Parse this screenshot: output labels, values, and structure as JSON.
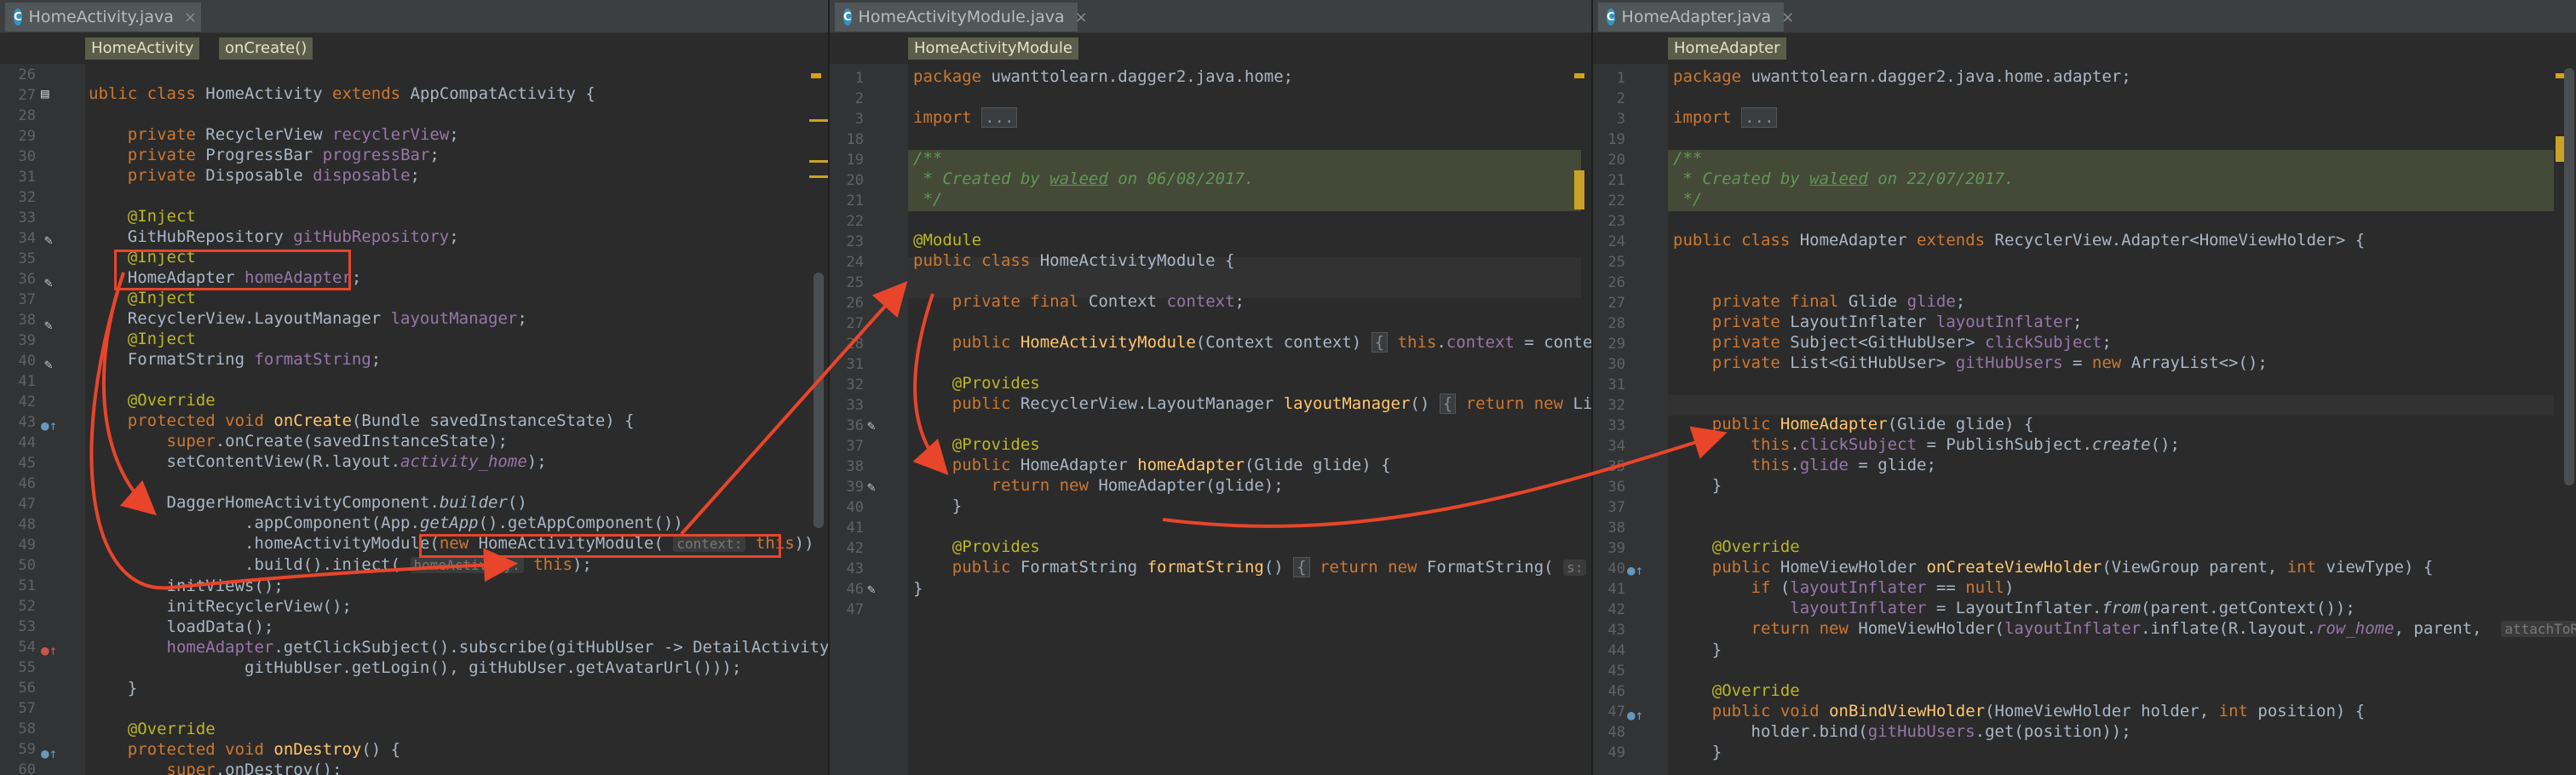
{
  "panes": [
    {
      "tab_label": "HomeActivity.java",
      "crumbs": [
        "HomeActivity",
        "onCreate()"
      ],
      "line_numbers": [
        "26",
        "27",
        "28",
        "29",
        "30",
        "31",
        "32",
        "33",
        "34",
        "35",
        "36",
        "37",
        "38",
        "39",
        "40",
        "41",
        "42",
        "43",
        "44",
        "45",
        "46",
        "47",
        "48",
        "49",
        "50",
        "51",
        "52",
        "53",
        "54",
        "55",
        "56",
        "57",
        "58",
        "59",
        "60"
      ]
    },
    {
      "tab_label": "HomeActivityModule.java",
      "crumbs": [
        "HomeActivityModule"
      ],
      "line_numbers": [
        "1",
        "2",
        "3",
        "18",
        "19",
        "20",
        "21",
        "22",
        "23",
        "24",
        "25",
        "26",
        "27",
        "28",
        "31",
        "32",
        "33",
        "36",
        "37",
        "38",
        "39",
        "40",
        "41",
        "42",
        "43",
        "46",
        "47"
      ]
    },
    {
      "tab_label": "HomeAdapter.java",
      "crumbs": [
        "HomeAdapter"
      ],
      "line_numbers": [
        "1",
        "2",
        "3",
        "19",
        "20",
        "21",
        "22",
        "23",
        "24",
        "25",
        "26",
        "27",
        "28",
        "29",
        "30",
        "31",
        "32",
        "33",
        "34",
        "35",
        "36",
        "37",
        "38",
        "39",
        "40",
        "41",
        "42",
        "43",
        "44",
        "45",
        "46",
        "47",
        "48",
        "49"
      ]
    }
  ],
  "colors": {
    "arrow": "#e8452b",
    "tab_icon": "#3592c4",
    "keyword": "#cc7832",
    "field": "#9876aa",
    "annotation": "#bbb529"
  },
  "icons": [
    "class-icon",
    "close-icon",
    "pencil-icon",
    "override-icon",
    "fold-icon"
  ]
}
